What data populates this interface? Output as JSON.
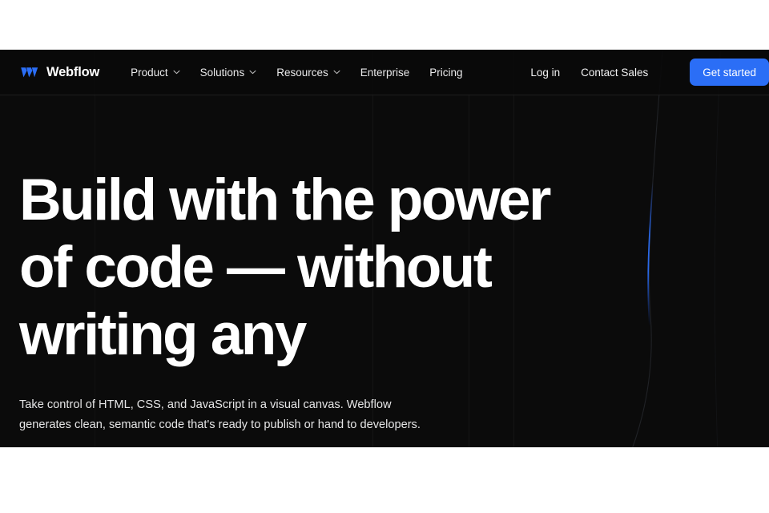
{
  "page": {
    "background_color": "#ffffff",
    "viewport_background": "#0b0b0b",
    "accent_color": "#2b6ef6",
    "text_color": "#ffffff"
  },
  "navbar": {
    "brand": {
      "name": "Webflow",
      "logo_icon": "webflow-w-mark",
      "logo_color": "#2b6ef6"
    },
    "links": [
      {
        "label": "Product",
        "has_dropdown": true,
        "icon": "chevron-down-icon"
      },
      {
        "label": "Solutions",
        "has_dropdown": true,
        "icon": "chevron-down-icon"
      },
      {
        "label": "Resources",
        "has_dropdown": true,
        "icon": "chevron-down-icon"
      },
      {
        "label": "Enterprise",
        "has_dropdown": false,
        "icon": ""
      },
      {
        "label": "Pricing",
        "has_dropdown": false,
        "icon": ""
      }
    ],
    "account_links": [
      {
        "label": "Log in"
      },
      {
        "label": "Contact Sales"
      }
    ],
    "cta": {
      "label": "Get started"
    }
  },
  "hero": {
    "headline_lines": [
      "Build with the power",
      "of code — without",
      "writing any"
    ],
    "subheading_lines": [
      "Take control of HTML, CSS, and JavaScript in a visual canvas. Webflow",
      "generates clean, semantic code that's ready to publish or hand to developers."
    ]
  }
}
